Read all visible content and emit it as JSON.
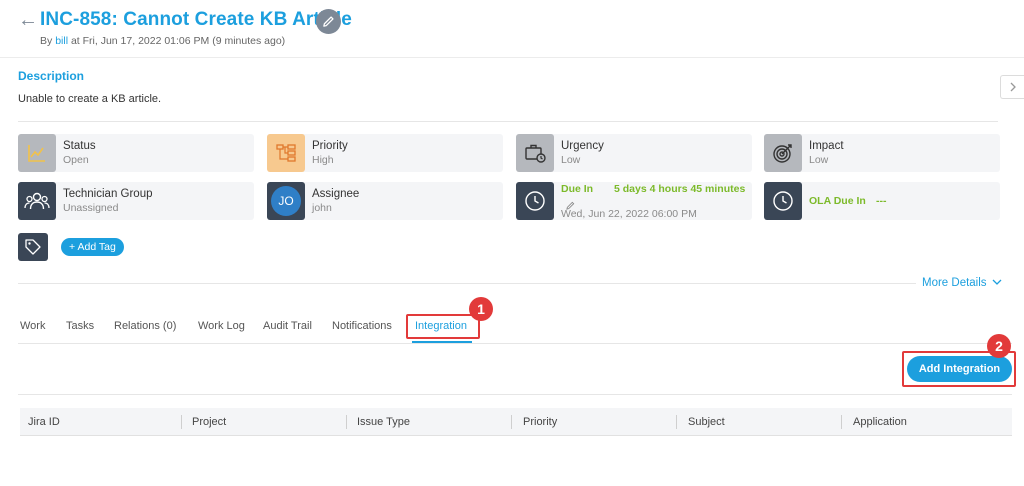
{
  "header": {
    "back_icon": "←",
    "title": "INC-858: Cannot Create KB Article",
    "by_prefix": "By",
    "by_user": "bill",
    "by_suffix": "at Fri, Jun 17, 2022 01:06 PM (9 minutes ago)"
  },
  "description": {
    "label": "Description",
    "text": "Unable to create a KB article."
  },
  "cards": {
    "status": {
      "label": "Status",
      "value": "Open",
      "icon": "chart-line-icon",
      "icon_bg": "#b5b8bd"
    },
    "priority": {
      "label": "Priority",
      "value": "High",
      "icon": "priority-flow-icon",
      "icon_bg": "#f7c98f"
    },
    "urgency": {
      "label": "Urgency",
      "value": "Low",
      "icon": "briefcase-clock-icon",
      "icon_bg": "#b5b8bd"
    },
    "impact": {
      "label": "Impact",
      "value": "Low",
      "icon": "target-icon",
      "icon_bg": "#b5b8bd"
    },
    "technician_group": {
      "label": "Technician Group",
      "value": "Unassigned",
      "icon": "users-icon",
      "icon_bg": "#3a4656"
    },
    "assignee": {
      "label": "Assignee",
      "value": "john",
      "initials": "JO",
      "icon_bg": "#3a4656"
    },
    "due_in": {
      "label": "Due In",
      "value": "5 days 4 hours 45 minutes",
      "date": "Wed, Jun 22, 2022 06:00 PM",
      "icon": "clock-icon",
      "icon_bg": "#3a4656"
    },
    "ola_due_in": {
      "label": "OLA Due In",
      "value": "---",
      "icon": "clock-icon",
      "icon_bg": "#3a4656"
    }
  },
  "tags": {
    "add_label": "+ Add Tag"
  },
  "more_details": "More Details",
  "tabs": [
    "Work",
    "Tasks",
    "Relations (0)",
    "Work Log",
    "Audit Trail",
    "Notifications",
    "Integration"
  ],
  "active_tab": "Integration",
  "callouts": [
    "1",
    "2"
  ],
  "add_integration_label": "Add Integration",
  "table": {
    "columns": [
      "Jira ID",
      "Project",
      "Issue Type",
      "Priority",
      "Subject",
      "Application"
    ]
  },
  "colors": {
    "accent": "#1c9fde",
    "green": "#7cba2a",
    "callout": "#e23a3a"
  }
}
